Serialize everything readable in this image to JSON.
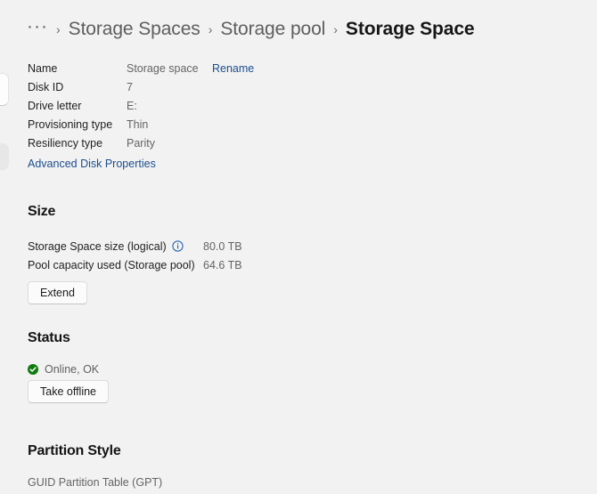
{
  "breadcrumb": {
    "overflow": "···",
    "separator": "›",
    "items": [
      {
        "label": "Storage Spaces",
        "current": false
      },
      {
        "label": "Storage pool",
        "current": false
      },
      {
        "label": "Storage Space",
        "current": true
      }
    ]
  },
  "properties": {
    "rows": [
      {
        "label": "Name",
        "value": "Storage space",
        "action": "Rename"
      },
      {
        "label": "Disk ID",
        "value": "7"
      },
      {
        "label": "Drive letter",
        "value": "E:"
      },
      {
        "label": "Provisioning type",
        "value": "Thin"
      },
      {
        "label": "Resiliency type",
        "value": "Parity"
      }
    ],
    "advanced_link": "Advanced Disk Properties"
  },
  "size": {
    "title": "Size",
    "rows": [
      {
        "label": "Storage Space size (logical)",
        "value": "80.0 TB",
        "info_icon": "info-icon"
      },
      {
        "label": "Pool capacity used (Storage pool)",
        "value": "64.6 TB"
      }
    ],
    "extend_button": "Extend"
  },
  "status": {
    "title": "Status",
    "icon": "check-circle-icon",
    "text": "Online, OK",
    "take_offline_button": "Take offline"
  },
  "partition": {
    "title": "Partition Style",
    "value": "GUID Partition Table (GPT)"
  },
  "colors": {
    "background": "#f2f2f2",
    "link": "#1c4e8f",
    "status_ok": "#0f7b0f",
    "info_accent": "#1b5aa8",
    "text_primary": "#1f1f1f",
    "text_secondary": "#646464"
  }
}
